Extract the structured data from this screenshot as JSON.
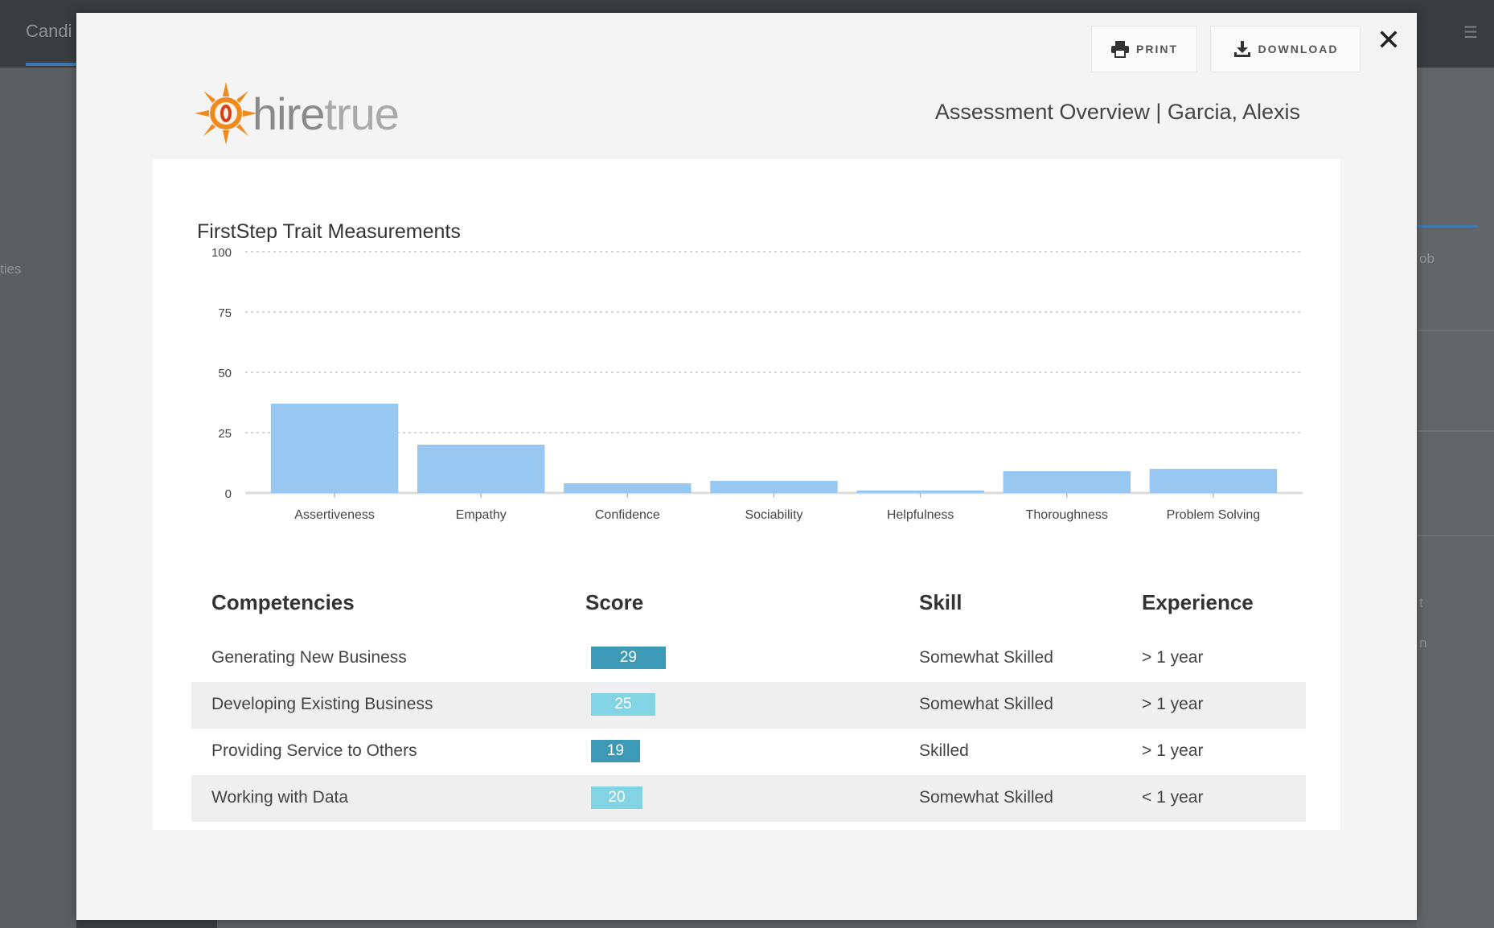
{
  "background_app": {
    "tab_label": "Candi",
    "left_fragment": "ties",
    "right_fragment_top": "ob",
    "right_fragment_mid": "t",
    "right_fragment_low": "n"
  },
  "modal": {
    "print_label": "PRINT",
    "download_label": "DOWNLOAD",
    "close_symbol": "✕",
    "logo_text_a": "hire",
    "logo_text_b": "true",
    "report_title": "Assessment Overview | Garcia, Alexis"
  },
  "colors": {
    "bar_fill": "#98c7f2",
    "score_dark": "#3d9ab6",
    "score_light": "#82d3e3",
    "logo_orange": "#f08a1c"
  },
  "chart_data": {
    "type": "bar",
    "title": "FirstStep Trait Measurements",
    "categories": [
      "Assertiveness",
      "Empathy",
      "Confidence",
      "Sociability",
      "Helpfulness",
      "Thoroughness",
      "Problem Solving"
    ],
    "values": [
      37,
      20,
      4,
      5,
      1,
      9,
      10
    ],
    "ylim": [
      0,
      100
    ],
    "yticks": [
      0,
      25,
      50,
      75,
      100
    ],
    "grid": true,
    "xlabel": "",
    "ylabel": ""
  },
  "competencies": {
    "headers": {
      "competency": "Competencies",
      "score": "Score",
      "skill": "Skill",
      "experience": "Experience"
    },
    "rows": [
      {
        "name": "Generating New Business",
        "score": "29",
        "score_value": 29,
        "shade": "dark",
        "skill": "Somewhat Skilled",
        "experience": "> 1 year"
      },
      {
        "name": "Developing Existing Business",
        "score": "25",
        "score_value": 25,
        "shade": "light",
        "skill": "Somewhat Skilled",
        "experience": "> 1 year"
      },
      {
        "name": "Providing Service to Others",
        "score": "19",
        "score_value": 19,
        "shade": "dark",
        "skill": "Skilled",
        "experience": "> 1 year"
      },
      {
        "name": "Working with Data",
        "score": "20",
        "score_value": 20,
        "shade": "light",
        "skill": "Somewhat Skilled",
        "experience": "< 1 year"
      }
    ]
  }
}
